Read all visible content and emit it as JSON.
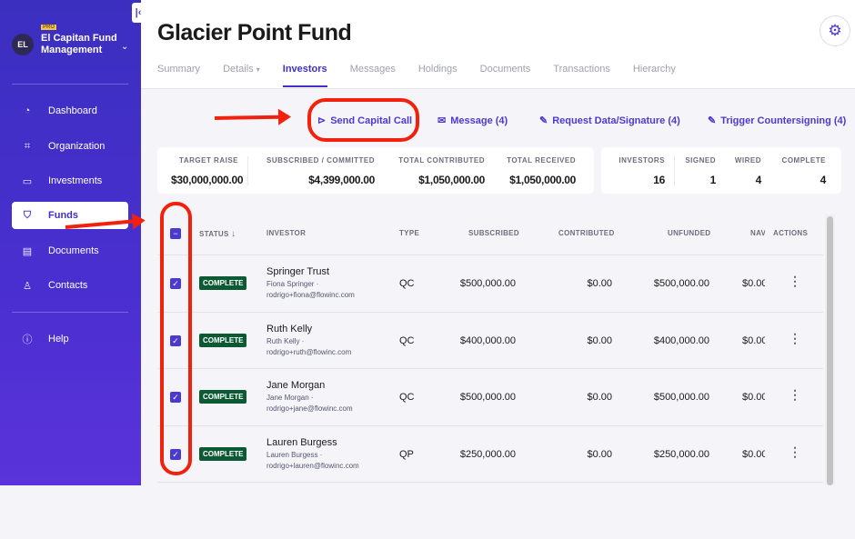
{
  "sidebar": {
    "collapse_icon": "collapse-left-icon",
    "avatar": "EL",
    "badge": "PRO",
    "org": "El Capitan Fund Management",
    "items": [
      {
        "label": "Dashboard",
        "icon": "gauge-icon"
      },
      {
        "label": "Organization",
        "icon": "org-icon"
      },
      {
        "label": "Investments",
        "icon": "briefcase-icon"
      },
      {
        "label": "Funds",
        "icon": "shield-icon",
        "active": true
      },
      {
        "label": "Documents",
        "icon": "document-icon"
      },
      {
        "label": "Contacts",
        "icon": "person-icon"
      }
    ],
    "help": "Help"
  },
  "header": {
    "title": "Glacier Point Fund",
    "tabs": [
      "Summary",
      "Details",
      "Investors",
      "Messages",
      "Holdings",
      "Documents",
      "Transactions",
      "Hierarchy"
    ],
    "active_tab": "Investors"
  },
  "actions": {
    "send": "Send Capital Call",
    "message": "Message (4)",
    "request": "Request Data/Signature (4)",
    "trigger": "Trigger Countersigning (4)"
  },
  "stats": [
    {
      "label": "TARGET RAISE",
      "value": "$30,000,000.00"
    },
    {
      "label": "SUBSCRIBED / COMMITTED",
      "value": "$4,399,000.00"
    },
    {
      "label": "TOTAL CONTRIBUTED",
      "value": "$1,050,000.00"
    },
    {
      "label": "TOTAL RECEIVED",
      "value": "$1,050,000.00"
    }
  ],
  "counts": [
    {
      "label": "INVESTORS",
      "value": "16"
    },
    {
      "label": "SIGNED",
      "value": "1"
    },
    {
      "label": "WIRED",
      "value": "4"
    },
    {
      "label": "COMPLETE",
      "value": "4"
    }
  ],
  "table": {
    "columns": [
      "STATUS",
      "INVESTOR",
      "TYPE",
      "SUBSCRIBED",
      "CONTRIBUTED",
      "UNFUNDED",
      "NAV",
      "ACTIONS"
    ],
    "rows": [
      {
        "status": "COMPLETE",
        "name": "Springer Trust",
        "contact": "Fiona Springer ·",
        "email": "rodrigo+fiona@flowinc.com",
        "type": "QC",
        "subscribed": "$500,000.00",
        "contributed": "$0.00",
        "unfunded": "$500,000.00",
        "nav": "$0.00"
      },
      {
        "status": "COMPLETE",
        "name": "Ruth Kelly",
        "contact": "Ruth Kelly ·",
        "email": "rodrigo+ruth@flowinc.com",
        "type": "QC",
        "subscribed": "$400,000.00",
        "contributed": "$0.00",
        "unfunded": "$400,000.00",
        "nav": "$0.00"
      },
      {
        "status": "COMPLETE",
        "name": "Jane Morgan",
        "contact": "Jane Morgan ·",
        "email": "rodrigo+jane@flowinc.com",
        "type": "QC",
        "subscribed": "$500,000.00",
        "contributed": "$0.00",
        "unfunded": "$500,000.00",
        "nav": "$0.00"
      },
      {
        "status": "COMPLETE",
        "name": "Lauren Burgess",
        "contact": "Lauren Burgess ·",
        "email": "rodrigo+lauren@flowinc.com",
        "type": "QP",
        "subscribed": "$250,000.00",
        "contributed": "$0.00",
        "unfunded": "$250,000.00",
        "nav": "$0.00"
      }
    ]
  },
  "colors": {
    "accent": "#4b3ad0",
    "sidebar": "#4330c8",
    "badge": "#0c5a33",
    "annotation": "#f2210e"
  }
}
